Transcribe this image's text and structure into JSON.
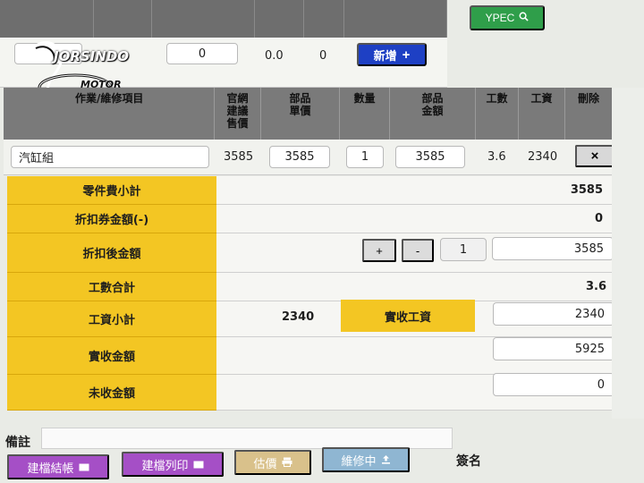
{
  "top_bar": {
    "row2": {
      "input1": "",
      "input2": "0",
      "val1": "0.0",
      "val2": "0"
    },
    "add_button": "新增",
    "ypec_button": "YPEC"
  },
  "logo": {
    "brand": "JORSINDO",
    "sub": "MOTOR CLUB"
  },
  "table": {
    "headers": {
      "item": "作業/維修項目",
      "official_price": "官網\n建議\n售價",
      "part_unit_price": "部品\n單價",
      "quantity": "數量",
      "part_amount": "部品\n金額",
      "labor_hours": "工數",
      "labor_cost": "工資",
      "delete": "刪除"
    },
    "row": {
      "item": "汽缸組",
      "official_price": "3585",
      "part_unit_price": "3585",
      "quantity": "1",
      "part_amount": "3585",
      "labor_hours": "3.6",
      "labor_cost": "2340",
      "delete": "×"
    }
  },
  "summary": {
    "parts_subtotal": {
      "label": "零件費小計",
      "value": "3585"
    },
    "coupon_amount": {
      "label": "折扣券金額(-)",
      "value": "0"
    },
    "after_discount": {
      "label": "折扣後金額",
      "plus": "+",
      "minus": "-",
      "qty": "1",
      "value": "3585"
    },
    "labor_hours_total": {
      "label": "工數合計",
      "value": "3.6"
    },
    "labor_subtotal": {
      "label": "工資小計",
      "value": "2340",
      "actual_label": "實收工資",
      "actual_value": "2340"
    },
    "received_amount": {
      "label": "實收金額",
      "value": "5925"
    },
    "unpaid_amount": {
      "label": "未收金額",
      "value": "0"
    }
  },
  "footer": {
    "note_label": "備註",
    "note_value": "",
    "btn_checkout": "建檔結帳",
    "btn_print": "建檔列印",
    "btn_estimate": "估價",
    "btn_repairing": "維修中",
    "sign_label": "簽名"
  },
  "colors": {
    "yellow": "#f3c623",
    "blue": "#1e40c4",
    "green": "#2f9e4a",
    "purple": "#a54fc6"
  }
}
